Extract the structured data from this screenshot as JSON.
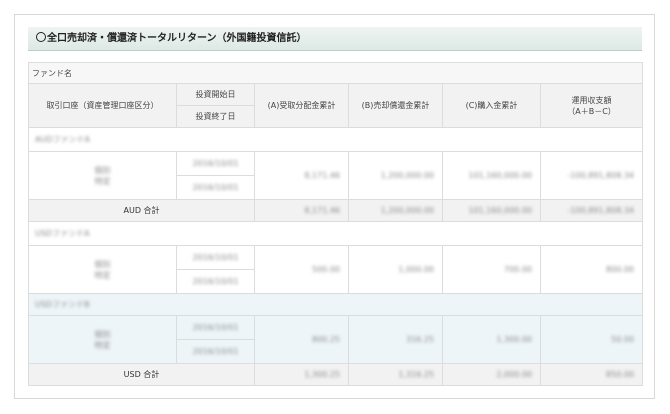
{
  "title": "全口売却済・償還済トータルリターン（外国籍投資信託）",
  "table": {
    "fund_name_header": "ファンド名",
    "account_header": "取引口座（資産管理口座区分）",
    "start_date_header": "投資開始日",
    "end_date_header": "投資終了日",
    "col_a": "(A)受取分配金累計",
    "col_b": "(B)売却償還金累計",
    "col_c": "(C)購入金累計",
    "col_total_line1": "運用収支額",
    "col_total_line2": "（A＋B－C）",
    "groups": [
      {
        "section_label": "AUDファンドA",
        "rows": [
          {
            "account_line1": "個別",
            "account_line2": "特定",
            "start": "2016/10/01",
            "end": "2016/10/01",
            "a": "8,171.46",
            "b": "1,200,000.00",
            "c": "101,160,000.00",
            "total": "-100,891,808.34"
          }
        ],
        "subtotal_label": "AUD 合計",
        "subtotal": {
          "a": "8,171.46",
          "b": "1,200,000.00",
          "c": "101,160,000.00",
          "total": "-100,891,808.34"
        }
      },
      {
        "section_label": "USDファンドA",
        "rows": [
          {
            "account_line1": "個別",
            "account_line2": "特定",
            "start": "2016/10/01",
            "end": "2016/10/01",
            "a": "500.00",
            "b": "1,000.00",
            "c": "700.00",
            "total": "800.00"
          }
        ]
      },
      {
        "section_label": "USDファンドB",
        "rows": [
          {
            "account_line1": "個別",
            "account_line2": "特定",
            "start": "2016/10/01",
            "end": "2016/10/01",
            "a": "800.25",
            "b": "316.25",
            "c": "1,300.00",
            "total": "50.00"
          }
        ],
        "subtotal_label": "USD 合計",
        "subtotal": {
          "a": "1,300.25",
          "b": "1,316.25",
          "c": "2,000.00",
          "total": "850.00"
        }
      }
    ]
  }
}
